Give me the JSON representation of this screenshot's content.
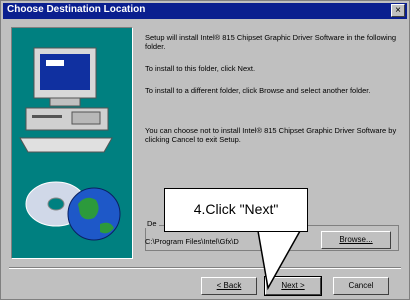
{
  "window": {
    "title": "Choose Destination Location",
    "close_glyph": "×"
  },
  "body": {
    "para1": "Setup will install Intel® 815 Chipset Graphic Driver Software in the following folder.",
    "para2": "To install to this folder, click Next.",
    "para3": "To install to a different folder, click Browse and select another folder.",
    "para4": "You can choose not to install Intel® 815 Chipset Graphic Driver Software by clicking Cancel to exit Setup."
  },
  "destination": {
    "group_label": "De",
    "path": "C:\\Program Files\\Intel\\Gfx\\D"
  },
  "buttons": {
    "browse": "Browse...",
    "back": "< Back",
    "next": "Next >",
    "cancel": "Cancel"
  },
  "callout": {
    "text": "4.Click \"Next\""
  },
  "colors": {
    "titlebar": "#0a1f8f",
    "dialog": "#c0c0c0",
    "art_background": "#008080"
  },
  "icons": [
    "computer-icon",
    "cd-disc-icon",
    "globe-icon"
  ]
}
